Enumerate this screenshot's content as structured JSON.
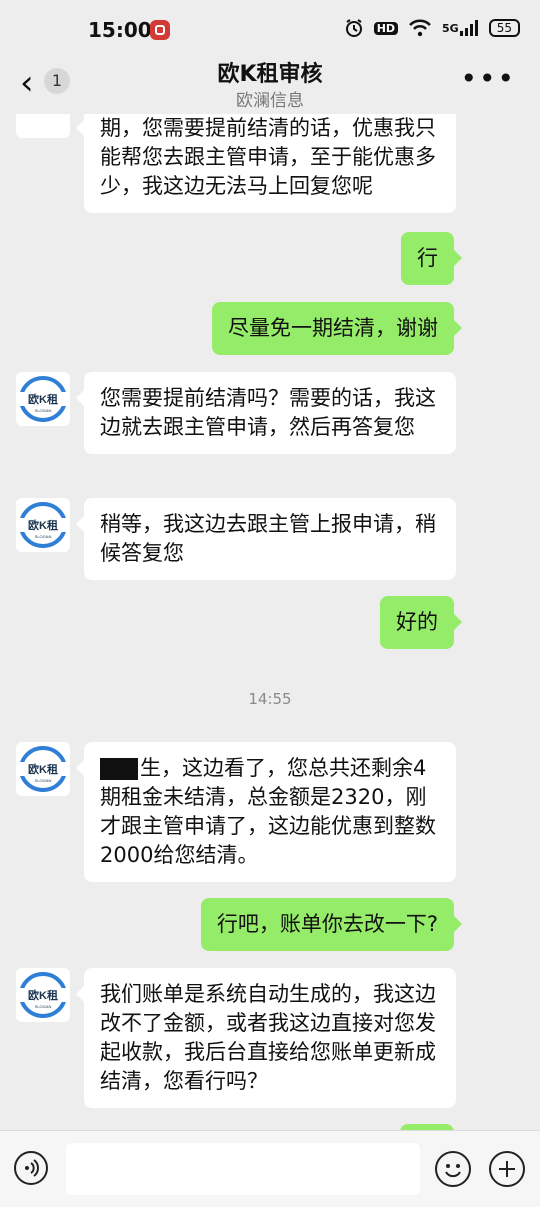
{
  "status_bar": {
    "time": "15:00",
    "hd_label": "HD",
    "network": "5G",
    "battery": "55"
  },
  "header": {
    "unread_count": "1",
    "title": "欧K租审核",
    "subtitle": "欧澜信息"
  },
  "avatar": {
    "brand_text": "欧K租",
    "slogan": "SLOGAN"
  },
  "messages": [
    {
      "side": "left",
      "text": "期，您需要提前结清的话，优惠我只能帮您去跟主管申请，至于能优惠多少，我这边无法马上回复您呢"
    },
    {
      "side": "right",
      "text": "行"
    },
    {
      "side": "right",
      "text": "尽量免一期结清，谢谢"
    },
    {
      "side": "left",
      "text": "您需要提前结清吗？需要的话，我这边就去跟主管申请，然后再答复您"
    },
    {
      "side": "left",
      "text": "稍等，我这边去跟主管上报申请，稍候答复您"
    },
    {
      "side": "right",
      "text": "好的"
    },
    {
      "side": "timestamp",
      "text": "14:55"
    },
    {
      "side": "left",
      "text": "生，这边看了，您总共还剩余4期租金未结清，总金额是2320，刚才跟主管申请了，这边能优惠到整数2000给您结清。"
    },
    {
      "side": "right",
      "text": "行吧，账单你去改一下?"
    },
    {
      "side": "left",
      "text": "我们账单是系统自动生成的，我这边改不了金额，或者我这边直接对您发起收款，我后台直接给您账单更新成结清，您看行吗？"
    }
  ],
  "colors": {
    "background": "#ededed",
    "self_bubble": "#95ec69",
    "other_bubble": "#ffffff",
    "brand_blue": "#2f7fd6"
  },
  "icons": [
    "back-arrow-icon",
    "more-icon",
    "voice-icon",
    "emoji-icon",
    "plus-icon"
  ]
}
